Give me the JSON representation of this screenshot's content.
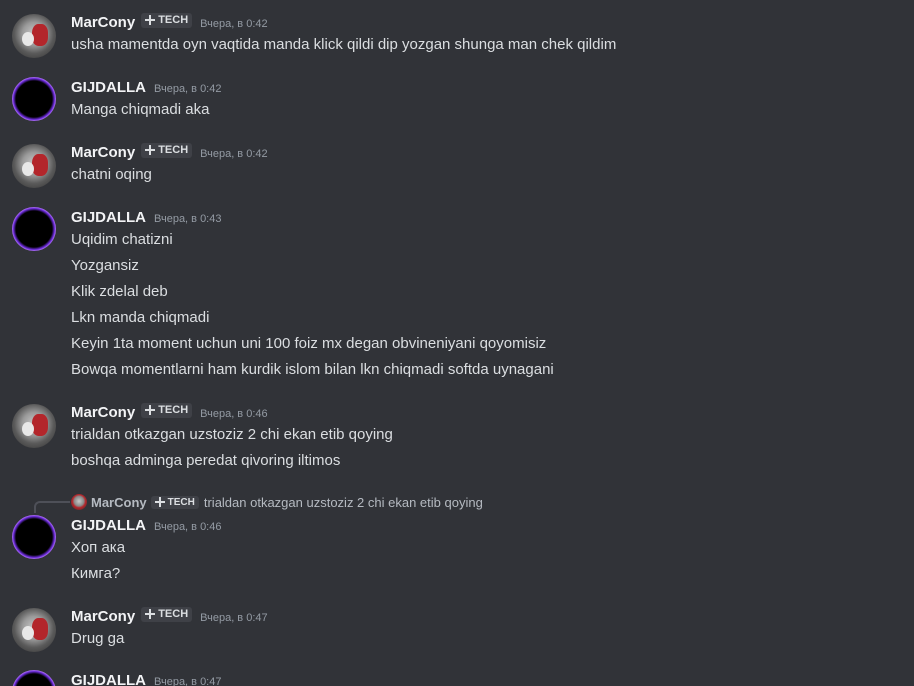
{
  "users": {
    "marcony": "MarCony",
    "gijdalla": "GIJDALLA"
  },
  "tag_label": "TECH",
  "messages": [
    {
      "author": "MarCony",
      "tag": "TECH",
      "time": "Вчера, в 0:42",
      "lines": [
        "usha mamentda oyn vaqtida manda klick qildi dip yozgan shunga man chek qildim"
      ]
    },
    {
      "author": "GIJDALLA",
      "tag": "",
      "time": "Вчера, в 0:42",
      "lines": [
        "Manga chiqmadi aka"
      ]
    },
    {
      "author": "MarCony",
      "tag": "TECH",
      "time": "Вчера, в 0:42",
      "lines": [
        "chatni oqing"
      ]
    },
    {
      "author": "GIJDALLA",
      "tag": "",
      "time": "Вчера, в 0:43",
      "lines": [
        "Uqidim chatizni",
        "Yozgansiz",
        "Klik zdelal deb",
        "Lkn manda chiqmadi",
        "Keyin 1ta moment uchun uni 100 foiz mx degan obvineniyani qoyomisiz",
        "Bowqa momentlarni ham kurdik islom bilan lkn chiqmadi softda uynagani"
      ]
    },
    {
      "author": "MarCony",
      "tag": "TECH",
      "time": "Вчера, в 0:46",
      "lines": [
        "trialdan otkazgan uzstoziz 2 chi ekan etib qoying",
        "boshqa adminga peredat qivoring iltimos"
      ]
    },
    {
      "author": "GIJDALLA",
      "tag": "",
      "time": "Вчера, в 0:46",
      "reply": {
        "author": "MarCony",
        "tag": "TECH",
        "text": "trialdan otkazgan uzstoziz 2 chi ekan etib qoying"
      },
      "lines": [
        "Хоп ака",
        "Кимга?"
      ]
    },
    {
      "author": "MarCony",
      "tag": "TECH",
      "time": "Вчера, в 0:47",
      "lines": [
        "Drug ga"
      ]
    },
    {
      "author": "GIJDALLA",
      "tag": "",
      "time": "Вчера, в 0:47",
      "lines": []
    }
  ]
}
